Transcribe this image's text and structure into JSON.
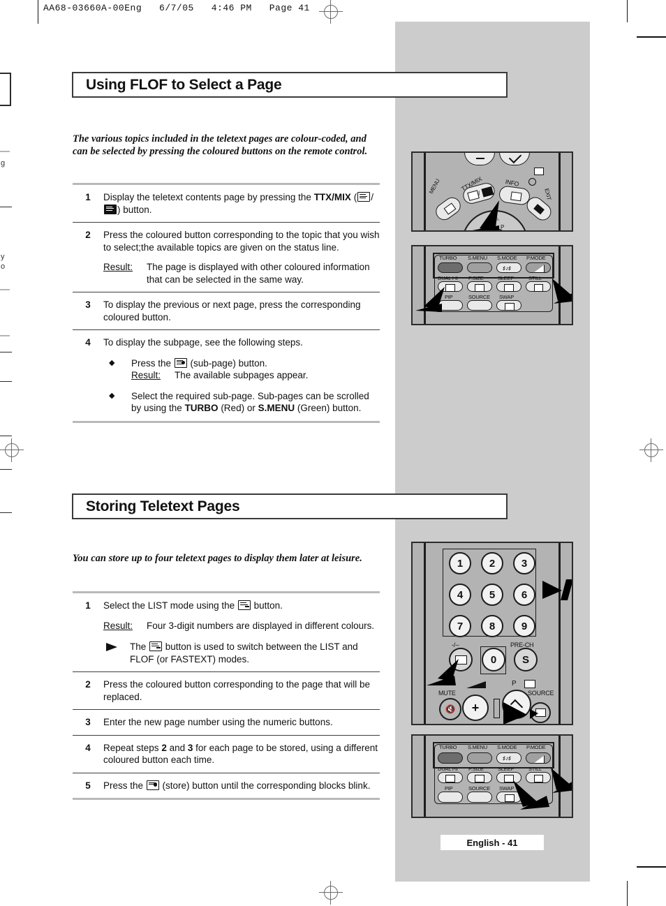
{
  "proof": {
    "header": "AA68-03660A-00Eng   6/7/05   4:46 PM   Page 41"
  },
  "bleed_fragments": [
    "g",
    "y",
    "o"
  ],
  "sections": [
    {
      "title": "Using FLOF to Select a Page",
      "intro": "The various topics included in the teletext pages are colour-coded, and can be selected by pressing the coloured buttons on the remote control.",
      "steps": [
        {
          "num": "1",
          "text_before": "Display the teletext contents page by pressing the ",
          "bold": "TTX/MIX",
          "text_after": " (",
          "text_end": ") button."
        },
        {
          "num": "2",
          "text": "Press the coloured button corresponding to the topic that you wish to select;the available topics are given on the status line.",
          "result_label": "Result:",
          "result_text": "The page is displayed with other coloured information that can be selected in the same way."
        },
        {
          "num": "3",
          "text": "To display the previous or next page, press the corresponding coloured button."
        },
        {
          "num": "4",
          "text": "To display the subpage, see the following steps.",
          "bullets": [
            {
              "text_before": "Press the ",
              "text_after": " (sub-page) button.",
              "result_label": "Result:",
              "result_text": "The available subpages appear."
            },
            {
              "text_before": "Select the required sub-page. Sub-pages can be scrolled by using the ",
              "bold1": "TURBO",
              "mid": " (Red) or ",
              "bold2": "S.MENU",
              "text_after": " (Green) button."
            }
          ]
        }
      ]
    },
    {
      "title": "Storing Teletext Pages",
      "intro": "You can store up to four teletext pages to display them later at leisure.",
      "steps": [
        {
          "num": "1",
          "text_before": "Select the LIST mode using the ",
          "text_after": " button.",
          "result_label": "Result:",
          "result_text": "Four 3-digit numbers are displayed in different colours.",
          "note_before": "The ",
          "note_after": " button is used to switch between the LIST and FLOF (or FASTEXT) modes."
        },
        {
          "num": "2",
          "text": "Press the coloured button corresponding to the page that will be replaced."
        },
        {
          "num": "3",
          "text": "Enter the new page number using the numeric buttons."
        },
        {
          "num": "4",
          "text_a": "Repeat steps ",
          "bold1": "2",
          "text_b": " and ",
          "bold2": "3",
          "text_c": " for each page to be stored, using a different coloured button each time."
        },
        {
          "num": "5",
          "text_before": "Press the ",
          "text_after": " (store) button until the corresponding blocks blink."
        }
      ]
    }
  ],
  "remotes": {
    "nav_remote": {
      "labels": {
        "menu": "MENU",
        "ttxmix": "TTX/MIX",
        "info": "INFO",
        "exit": "EXIT",
        "p_up": "P"
      }
    },
    "function_remote": {
      "row1": [
        "TURBO",
        "S.MENU",
        "S.MODE",
        "P.MODE"
      ],
      "row2": [
        "DUAL I-II",
        "P.SIZE",
        "SLEEP",
        "STILL"
      ],
      "row3": [
        "PIP",
        "SOURCE",
        "SWAP"
      ]
    },
    "keypad_remote": {
      "keys": [
        "1",
        "2",
        "3",
        "4",
        "5",
        "6",
        "7",
        "8",
        "9"
      ],
      "zero": "0",
      "dash_label": "-/--",
      "prech_label": "PRE-CH",
      "mute_label": "MUTE",
      "p_label": "P",
      "source_label": "SOURCE"
    }
  },
  "footer": {
    "page_label": "English - 41"
  },
  "colors": {
    "gray_column": "#cccccc",
    "banner_border": "#3a3a3a",
    "rule_light": "#b9b9b9",
    "rule_dark": "#3d3d3d",
    "remote_body": "#b3b3b3"
  }
}
